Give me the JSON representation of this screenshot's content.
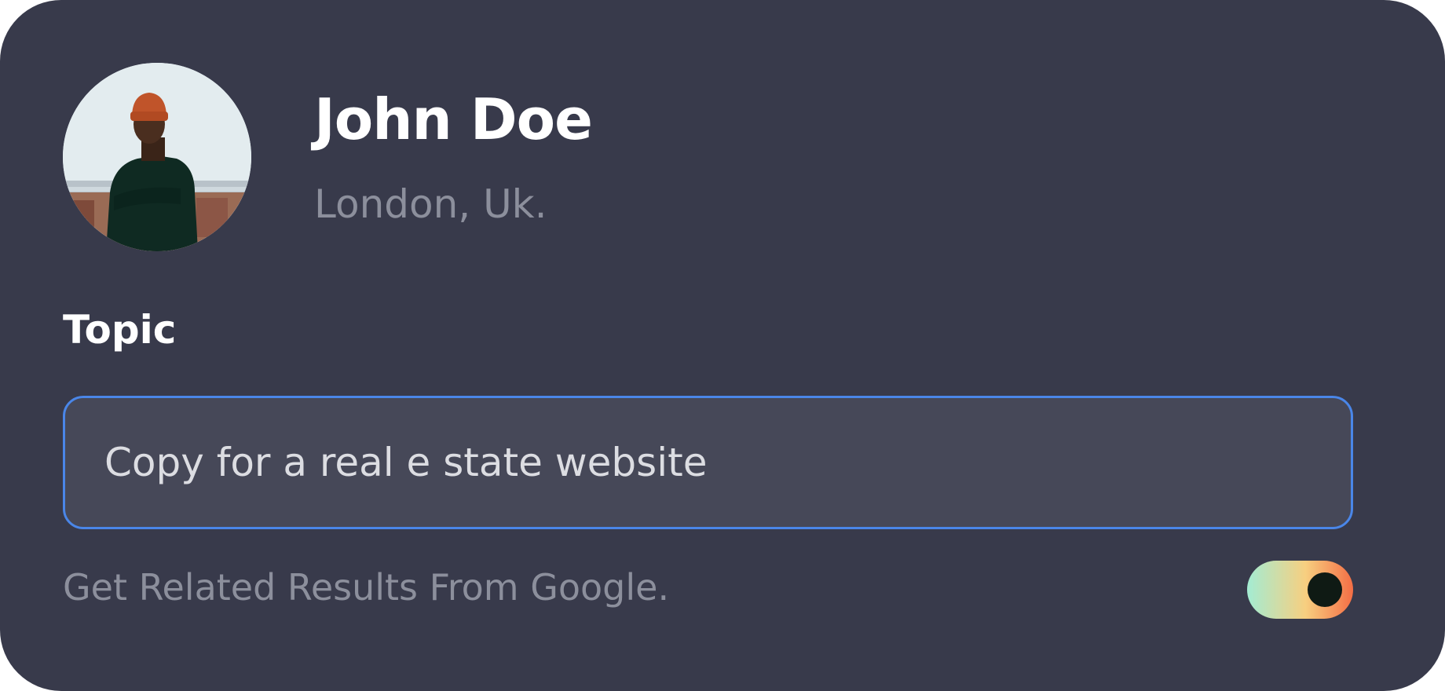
{
  "profile": {
    "name": "John Doe",
    "location": "London, Uk."
  },
  "topic": {
    "label": "Topic",
    "value": "Copy for a real e state website"
  },
  "google_toggle": {
    "label": "Get Related Results From Google.",
    "enabled": true
  },
  "colors": {
    "card_background": "#383a4b",
    "input_border": "#4a86e8",
    "toggle_gradient": [
      "#a3ecd3",
      "#f7cf80",
      "#f46e45"
    ]
  },
  "icons": {
    "avatar": "profile-photo"
  }
}
